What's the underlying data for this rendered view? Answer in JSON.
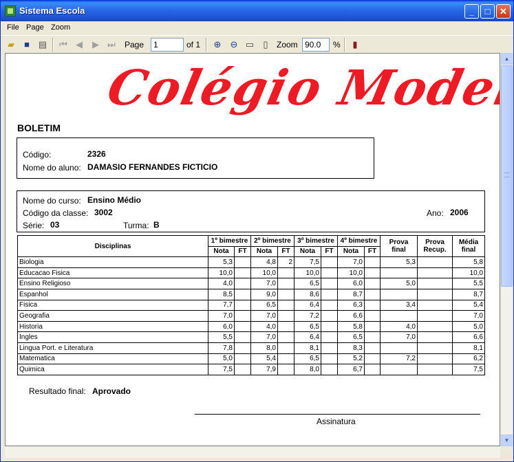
{
  "window": {
    "title": "Sistema Escola"
  },
  "menu": {
    "file": "File",
    "page": "Page",
    "zoom": "Zoom"
  },
  "toolbar": {
    "page_label": "Page",
    "page_value": "1",
    "of_label": "of 1",
    "zoom_label": "Zoom",
    "zoom_value": "90.0",
    "percent": "%"
  },
  "report": {
    "logo": "Colégio Modelo",
    "heading": "BOLETIM",
    "student": {
      "codigo_label": "Código:",
      "codigo": "2326",
      "nome_label": "Nome do aluno:",
      "nome": "DAMASIO FERNANDES FICTICIO"
    },
    "course": {
      "curso_label": "Nome do curso:",
      "curso": "Ensino Médio",
      "classe_label": "Código da classe:",
      "classe": "3002",
      "ano_label": "Ano:",
      "ano": "2006",
      "serie_label": "Série:",
      "serie": "03",
      "turma_label": "Turma:",
      "turma": "B"
    },
    "table": {
      "col_disciplinas": "Disciplinas",
      "bim1": "1º bimestre",
      "bim2": "2º bimestre",
      "bim3": "3º bimestre",
      "bim4": "4º bimestre",
      "nota": "Nota",
      "ft": "FT",
      "prova_final": "Prova final",
      "prova_recup": "Prova Recup.",
      "media_final": "Média final",
      "rows": [
        [
          "Biologia",
          "5,3",
          "",
          "4,8",
          "2",
          "7,5",
          "",
          "7,0",
          "",
          "5,3",
          "",
          "5,8"
        ],
        [
          "Educacao Fisica",
          "10,0",
          "",
          "10,0",
          "",
          "10,0",
          "",
          "10,0",
          "",
          "",
          "",
          "10,0"
        ],
        [
          "Ensino Religioso",
          "4,0",
          "",
          "7,0",
          "",
          "6,5",
          "",
          "6,0",
          "",
          "5,0",
          "",
          "5,5"
        ],
        [
          "Espanhol",
          "8,5",
          "",
          "9,0",
          "",
          "8,6",
          "",
          "8,7",
          "",
          "",
          "",
          "8,7"
        ],
        [
          "Fisica",
          "7,7",
          "",
          "6,5",
          "",
          "6,4",
          "",
          "6,3",
          "",
          "3,4",
          "",
          "5,4"
        ],
        [
          "Geografia",
          "7,0",
          "",
          "7,0",
          "",
          "7,2",
          "",
          "6,6",
          "",
          "",
          "",
          "7,0"
        ],
        [
          "Historia",
          "6,0",
          "",
          "4,0",
          "",
          "6,5",
          "",
          "5,8",
          "",
          "4,0",
          "",
          "5,0"
        ],
        [
          "Ingles",
          "5,5",
          "",
          "7,0",
          "",
          "6,4",
          "",
          "6,5",
          "",
          "7,0",
          "",
          "6,6"
        ],
        [
          "Lingua Port. e Literatura",
          "7,8",
          "",
          "8,0",
          "",
          "8,1",
          "",
          "8,3",
          "",
          "",
          "",
          "8,1"
        ],
        [
          "Matematica",
          "5,0",
          "",
          "5,4",
          "",
          "6,5",
          "",
          "5,2",
          "",
          "7,2",
          "",
          "6,2"
        ],
        [
          "Quimica",
          "7,5",
          "",
          "7,9",
          "",
          "8,0",
          "",
          "6,7",
          "",
          "",
          "",
          "7,5"
        ]
      ]
    },
    "resultado_label": "Resultado final:",
    "resultado": "Aprovado",
    "assinatura": "Assinatura"
  }
}
